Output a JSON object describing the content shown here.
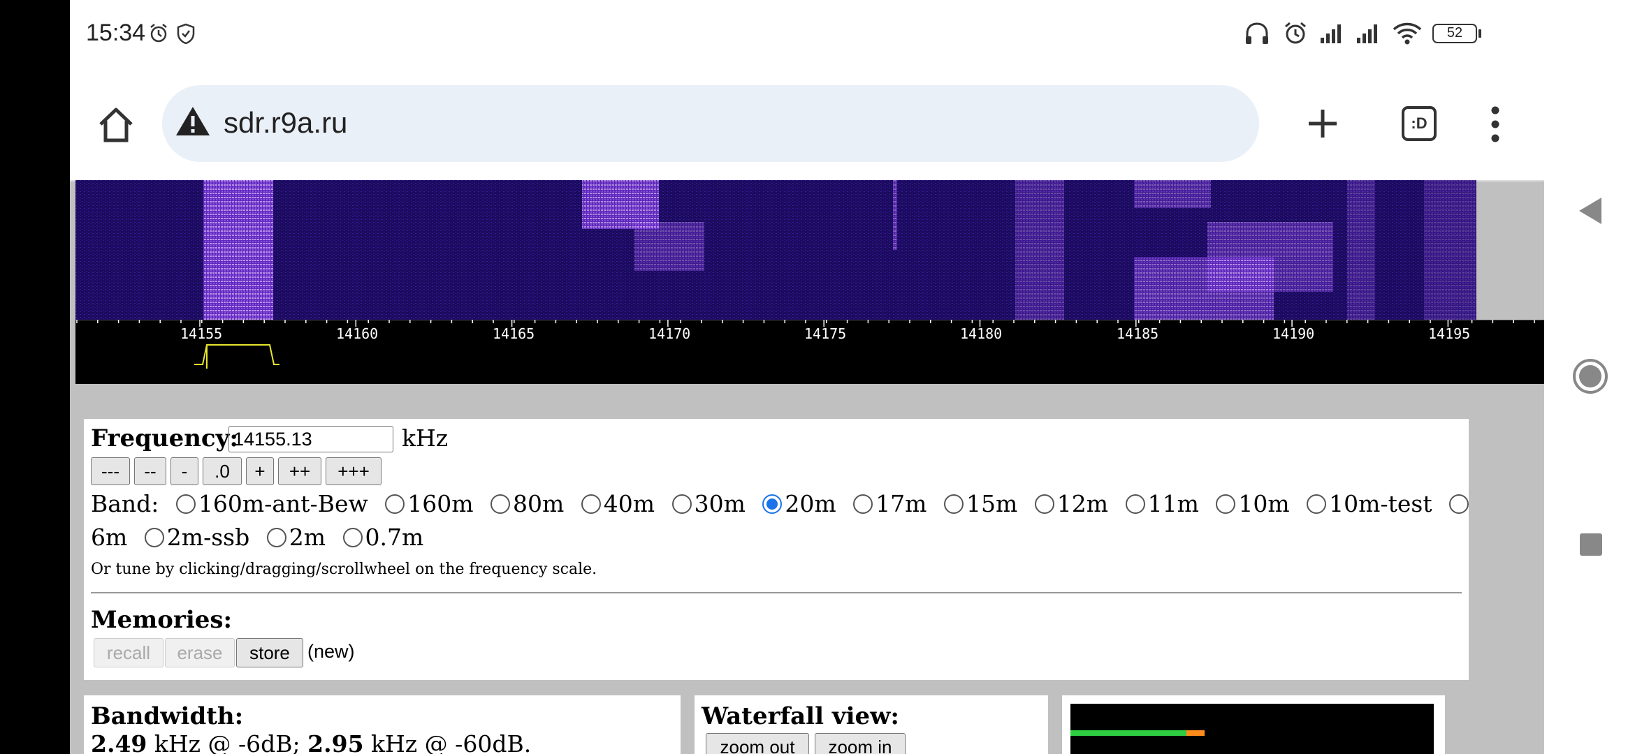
{
  "status": {
    "time": "15:34",
    "battery": "52"
  },
  "browser": {
    "url": "sdr.r9a.ru",
    "tabs_icon_label": ":D"
  },
  "scale": {
    "ticks": [
      "14155",
      "14160",
      "14165",
      "14170",
      "14175",
      "14180",
      "14185",
      "14190",
      "14195"
    ]
  },
  "frequency": {
    "label": "Frequency:",
    "value": "14155.13",
    "unit": "kHz",
    "steps": [
      "---",
      "--",
      "-",
      ".0",
      "+",
      "++",
      "+++"
    ],
    "band_label": "Band:",
    "bands": [
      "160m-ant-Bew",
      "160m",
      "80m",
      "40m",
      "30m",
      "20m",
      "17m",
      "15m",
      "12m",
      "11m",
      "10m",
      "10m-test",
      "6m",
      "2m-ssb",
      "2m",
      "0.7m"
    ],
    "selected_band": "20m",
    "hint": "Or tune by clicking/dragging/scrollwheel on the frequency scale."
  },
  "memories": {
    "label": "Memories:",
    "recall": "recall",
    "erase": "erase",
    "store": "store",
    "new_note": "(new)"
  },
  "bandwidth": {
    "label": "Bandwidth:",
    "val1": "2.49",
    "text1": "kHz @ -6dB;",
    "val2": "2.95",
    "text2": "kHz @ -60dB."
  },
  "waterfall_view": {
    "label": "Waterfall view:",
    "zoom_out": "zoom out",
    "zoom_in": "zoom in"
  },
  "colors": {
    "waterfall_bg": "#1a0a5a",
    "signal": "#b36bff",
    "accent": "#1a73e8",
    "meter_green": "#2ecc40",
    "meter_orange": "#ff8c1a"
  }
}
